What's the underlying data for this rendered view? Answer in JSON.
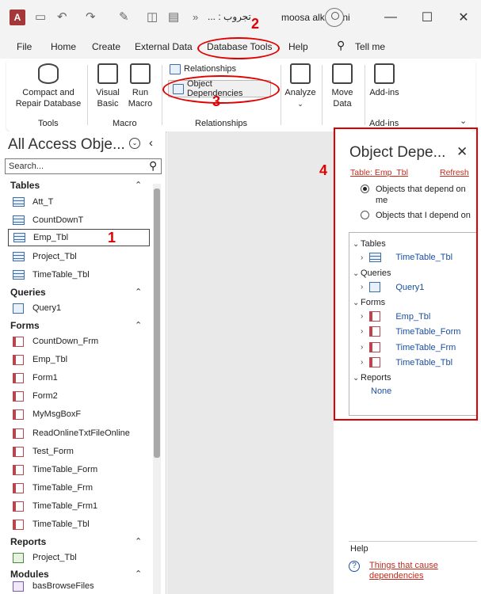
{
  "titlebar": {
    "app_letter": "A",
    "title": "... : تجروب",
    "overflow": "»",
    "user": "moosa alkalbani",
    "minimize": "—",
    "maximize": "☐",
    "close": "✕"
  },
  "menu": [
    "File",
    "Home",
    "Create",
    "External Data",
    "Database Tools",
    "Help"
  ],
  "tell_me": "Tell me",
  "ribbon": {
    "compact": "Compact and Repair Database",
    "tools_group": "Tools",
    "visual_basic": "Visual Basic",
    "run_macro": "Run Macro",
    "macro_group": "Macro",
    "relationships": "Relationships",
    "object_dependencies": "Object Dependencies",
    "relationships_group": "Relationships",
    "analyze": "Analyze",
    "move_data": "Move Data",
    "add_ins": "Add-ins",
    "addins_group": "Add-ins"
  },
  "nav": {
    "title": "All Access Obje...",
    "search_placeholder": "Search...",
    "categories": {
      "tables": "Tables",
      "queries": "Queries",
      "forms": "Forms",
      "reports": "Reports",
      "modules": "Modules"
    },
    "tables": [
      "Att_T",
      "CountDownT",
      "Emp_Tbl",
      "Project_Tbl",
      "TimeTable_Tbl"
    ],
    "queries": [
      "Query1"
    ],
    "forms": [
      "CountDown_Frm",
      "Emp_Tbl",
      "Form1",
      "Form2",
      "MyMsgBoxF",
      "ReadOnlineTxtFileOnline",
      "Test_Form",
      "TimeTable_Form",
      "TimeTable_Frm",
      "TimeTable_Frm1",
      "TimeTable_Tbl"
    ],
    "reports": [
      "Project_Tbl"
    ],
    "modules": [
      "basBrowseFiles"
    ]
  },
  "deps": {
    "title": "Object Depe...",
    "table_link": "Table: Emp_Tbl",
    "refresh": "Refresh",
    "opt1": "Objects that depend on me",
    "opt2": "Objects that I depend on",
    "tables_label": "Tables",
    "tables": [
      "TimeTable_Tbl"
    ],
    "queries_label": "Queries",
    "queries": [
      "Query1"
    ],
    "forms_label": "Forms",
    "forms": [
      "Emp_Tbl",
      "TimeTable_Form",
      "TimeTable_Frm",
      "TimeTable_Tbl"
    ],
    "reports_label": "Reports",
    "none": "None",
    "help_label": "Help",
    "help_link": "Things that cause dependencies"
  },
  "annotations": [
    "1",
    "2",
    "3",
    "4"
  ],
  "colors": {
    "annotation": "#e00000",
    "access_red": "#a4373a",
    "link_red": "#c42b1c",
    "link_blue": "#1a4fa0"
  }
}
